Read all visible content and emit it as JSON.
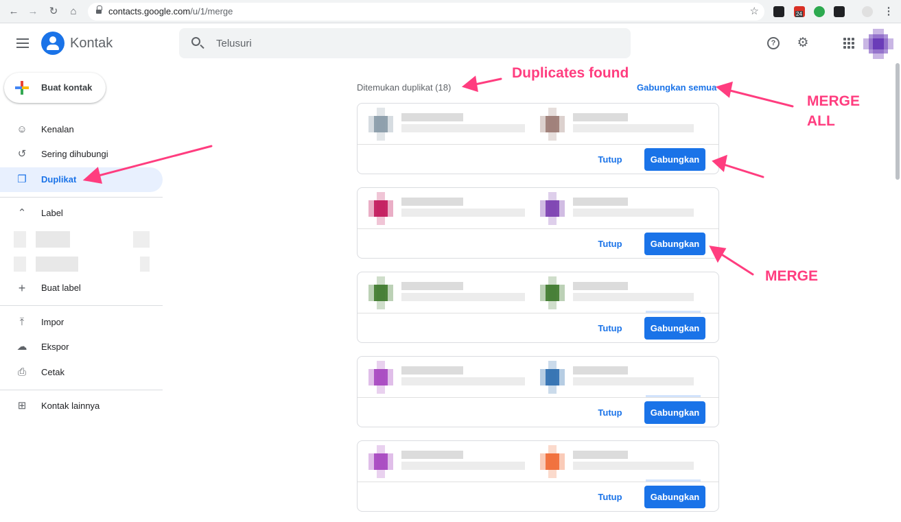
{
  "browser": {
    "url_domain": "contacts.google.com",
    "url_path": "/u/1/merge",
    "badge_count": "24"
  },
  "app": {
    "title": "Kontak",
    "search_placeholder": "Telusuri"
  },
  "sidebar": {
    "create_label": "Buat kontak",
    "items": [
      {
        "label": "Kenalan",
        "icon": "person-icon"
      },
      {
        "label": "Sering dihubungi",
        "icon": "history-icon"
      },
      {
        "label": "Duplikat",
        "icon": "duplicate-icon"
      }
    ],
    "labels_header": "Label",
    "create_label_item": "Buat label",
    "actions": [
      {
        "label": "Impor",
        "icon": "upload-icon"
      },
      {
        "label": "Ekspor",
        "icon": "cloud-download-icon"
      },
      {
        "label": "Cetak",
        "icon": "print-icon"
      }
    ],
    "other_contacts": "Kontak lainnya"
  },
  "main": {
    "found_text": "Ditemukan duplikat (18)",
    "merge_all": "Gabungkan semua",
    "cards": [
      {
        "close": "Tutup",
        "merge": "Gabungkan",
        "colors": [
          "#8a9ba8",
          "#9c7b74"
        ]
      },
      {
        "close": "Tutup",
        "merge": "Gabungkan",
        "colors": [
          "#c2185b",
          "#7b3fb0"
        ]
      },
      {
        "close": "Tutup",
        "merge": "Gabungkan",
        "colors": [
          "#3f7a2e",
          "#3f7a2e"
        ]
      },
      {
        "close": "Tutup",
        "merge": "Gabungkan",
        "colors": [
          "#a646c0",
          "#2f6fb0"
        ]
      },
      {
        "close": "Tutup",
        "merge": "Gabungkan",
        "colors": [
          "#a646c0",
          "#f06a35"
        ]
      }
    ]
  },
  "annotations": {
    "duplicates_found": "Duplicates found",
    "merge_all_line1": "MERGE",
    "merge_all_line2": "ALL",
    "merge": "MERGE",
    "color": "#ff3d7f"
  },
  "colors": {
    "accent": "#1a73e8",
    "active_bg": "#e8f0fe"
  }
}
